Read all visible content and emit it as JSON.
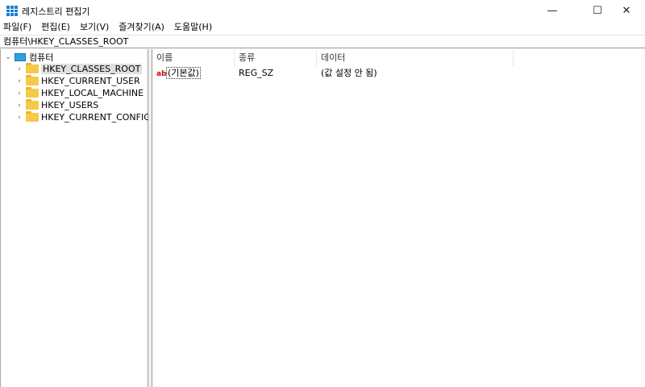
{
  "window": {
    "title": "레지스트리 편집기",
    "minimize": "—",
    "maximize": "☐",
    "close": "✕"
  },
  "menu": [
    "파일(F)",
    "편집(E)",
    "보기(V)",
    "즐겨찾기(A)",
    "도움말(H)"
  ],
  "address": "컴퓨터\\HKEY_CLASSES_ROOT",
  "tree": {
    "root": "컴퓨터",
    "items": [
      "HKEY_CLASSES_ROOT",
      "HKEY_CURRENT_USER",
      "HKEY_LOCAL_MACHINE",
      "HKEY_USERS",
      "HKEY_CURRENT_CONFIG"
    ]
  },
  "columns": [
    "이름",
    "종류",
    "데이터"
  ],
  "rows": [
    {
      "name": "(기본값)",
      "type": "REG_SZ",
      "data": "(값 설정 안 됨)"
    }
  ]
}
